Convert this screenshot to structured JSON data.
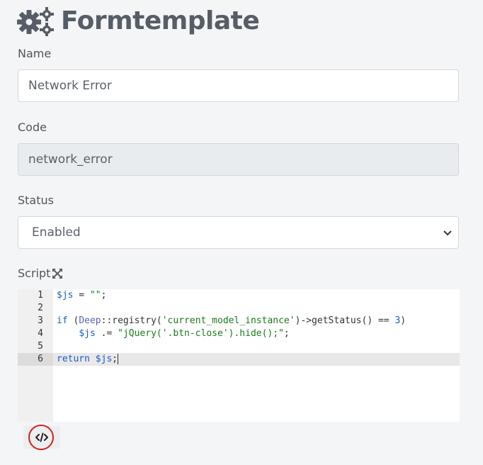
{
  "header": {
    "title": "Formtemplate",
    "icon": "gears-icon"
  },
  "form": {
    "name": {
      "label": "Name",
      "value": "Network Error"
    },
    "code": {
      "label": "Code",
      "value": "network_error"
    },
    "status": {
      "label": "Status",
      "value": "Enabled"
    },
    "script": {
      "label": "Script",
      "lines": [
        {
          "number": "1"
        },
        {
          "number": "2"
        },
        {
          "number": "3"
        },
        {
          "number": "4"
        },
        {
          "number": "5"
        },
        {
          "number": "6"
        }
      ],
      "tokens": {
        "l1_var": "$js",
        "l1_rest": " = ",
        "l1_str": "\"\"",
        "l1_end": ";",
        "l3_kw": "if",
        "l3_open": " (",
        "l3_cls": "Deep",
        "l3_sep": "::",
        "l3_fn": "registry(",
        "l3_str": "'current_model_instance'",
        "l3_call": ")->getStatus() == ",
        "l3_num": "3",
        "l3_close": ")",
        "l4_indent": "    ",
        "l4_var": "$js",
        "l4_op": " .= ",
        "l4_str": "\"jQuery('.btn-close').hide();\"",
        "l4_end": ";",
        "l6_kw": "return",
        "l6_sp": " ",
        "l6_var": "$js",
        "l6_end": ";"
      }
    }
  },
  "toolbar": {
    "code_button_icon": "code-icon",
    "highlight_color": "#d42020"
  }
}
